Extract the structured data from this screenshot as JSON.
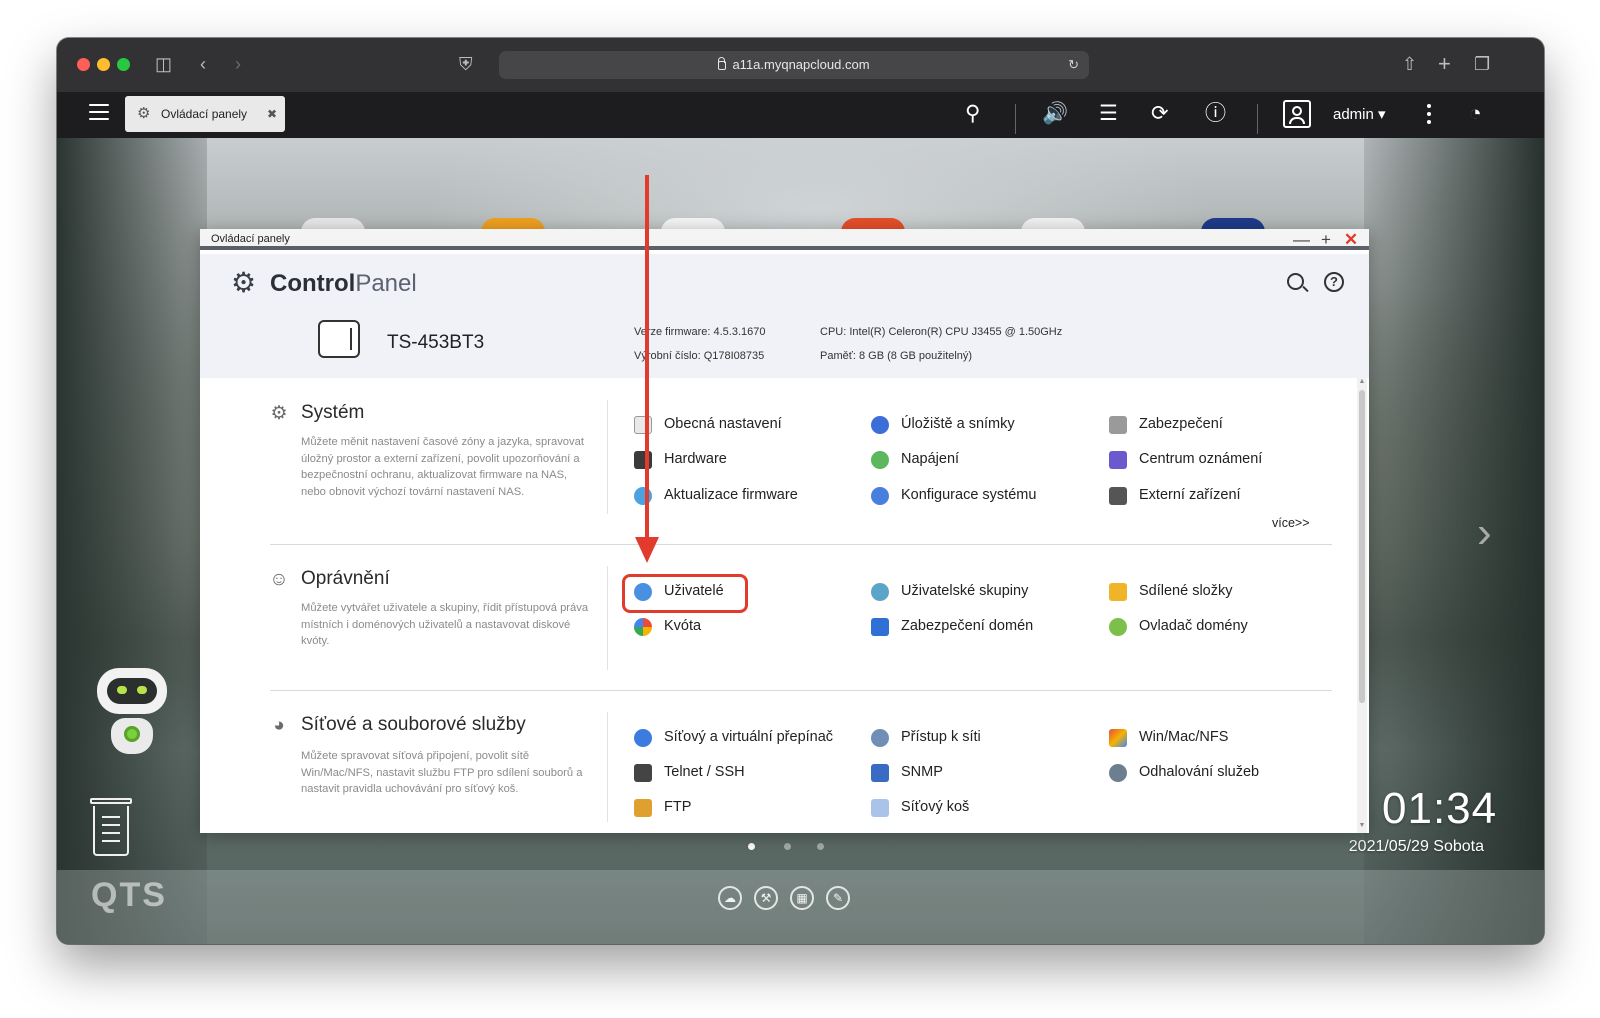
{
  "browser": {
    "url": "a11a.myqnapcloud.com"
  },
  "qts_topbar": {
    "tab_label": "Ovládací panely",
    "user_label": "admin ▾",
    "icons": [
      "menu-icon",
      "search-icon",
      "volume-icon",
      "tasks-icon",
      "sync-icon",
      "info-icon",
      "user-icon",
      "more-icon",
      "dashboard-icon"
    ]
  },
  "window": {
    "title": "Ovládací panely",
    "buttons": [
      "—",
      "+",
      "✕"
    ]
  },
  "control_panel": {
    "title_bold": "Control",
    "title_light": "Panel",
    "device_model": "TS-453BT3",
    "firmware_label": "Verze firmware:",
    "firmware_value": "4.5.3.1670",
    "serial_label": "Výrobní číslo:",
    "serial_value": "Q178I08735",
    "cpu_label": "CPU:",
    "cpu_value": "Intel(R) Celeron(R) CPU J3455 @ 1.50GHz",
    "memory_label": "Paměť:",
    "memory_value": "8 GB (8 GB použitelný)"
  },
  "sections": {
    "system": {
      "title": "Systém",
      "description": "Můžete měnit nastavení časové zóny a jazyka, spravovat úložný prostor a externí zařízení, povolit upozorňování a bezpečnostní ochranu, aktualizovat firmware na NAS, nebo obnovit výchozí tovární nastavení NAS.",
      "items": [
        "Obecná nastavení",
        "Úložiště a snímky",
        "Zabezpečení",
        "Hardware",
        "Napájení",
        "Centrum oznámení",
        "Aktualizace firmware",
        "Konfigurace systému",
        "Externí zařízení"
      ],
      "more": "více>>"
    },
    "privileges": {
      "title": "Oprávnění",
      "description": "Můžete vytvářet uživatele a skupiny, řídit přístupová práva místních i doménových uživatelů a nastavovat diskové kvóty.",
      "items": [
        "Uživatelé",
        "Uživatelské skupiny",
        "Sdílené složky",
        "Kvóta",
        "Zabezpečení domén",
        "Ovladač domény"
      ]
    },
    "network": {
      "title": "Síťové a souborové služby",
      "description": "Můžete spravovat síťová připojení, povolit sítě Win/Mac/NFS, nastavit službu FTP pro sdílení souborů a nastavit pravidla uchovávání pro síťový koš.",
      "items": [
        "Síťový a virtuální přepínač",
        "Přístup k síti",
        "Win/Mac/NFS",
        "Telnet / SSH",
        "SNMP",
        "Odhalování služeb",
        "FTP",
        "Síťový koš"
      ]
    }
  },
  "desktop": {
    "clock": "01:34",
    "date": "2021/05/29 Sobota",
    "logo": "QTS"
  },
  "colors": {
    "annotation": "#e23b2e",
    "header_bg": "#f0f2f7"
  }
}
